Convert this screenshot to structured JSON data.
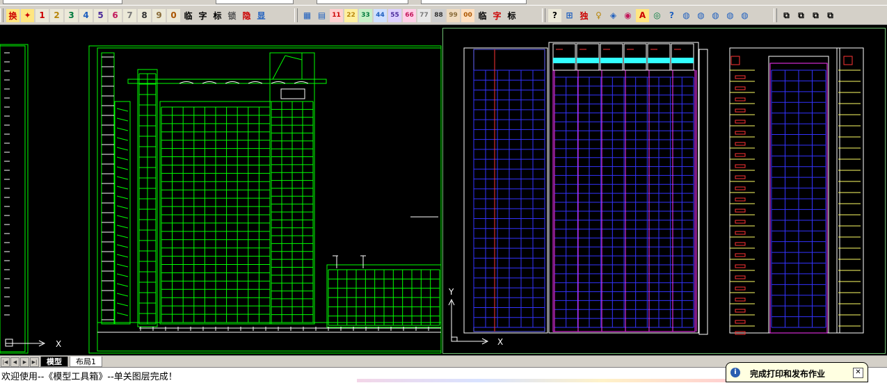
{
  "toolbar": {
    "group1": [
      {
        "label": "换",
        "color": "#cc0000",
        "bg": "#ffe680"
      },
      {
        "label": "✦",
        "color": "#cc0000",
        "bg": "#ffe680"
      },
      {
        "label": "1",
        "color": "#cc0000",
        "bg": "#ece9d8"
      },
      {
        "label": "2",
        "color": "#b8860b",
        "bg": "#ece9d8"
      },
      {
        "label": "3",
        "color": "#007a3d",
        "bg": "#ece9d8"
      },
      {
        "label": "4",
        "color": "#1e5fbf",
        "bg": "#ece9d8"
      },
      {
        "label": "5",
        "color": "#4b2b9b",
        "bg": "#ece9d8"
      },
      {
        "label": "6",
        "color": "#c2185b",
        "bg": "#ece9d8"
      },
      {
        "label": "7",
        "color": "#7a7a7a",
        "bg": "#ece9d8"
      },
      {
        "label": "8",
        "color": "#333333",
        "bg": "#ece9d8"
      },
      {
        "label": "9",
        "color": "#8a6d3b",
        "bg": "#ece9d8"
      },
      {
        "label": "0",
        "color": "#aa5500",
        "bg": "#ece9d8"
      },
      {
        "label": "临",
        "color": "#000000",
        "bg": "#d4d0c8"
      },
      {
        "label": "字",
        "color": "#000000",
        "bg": "#d4d0c8"
      },
      {
        "label": "标",
        "color": "#000000",
        "bg": "#d4d0c8"
      },
      {
        "label": "锁",
        "color": "#555555",
        "bg": "#d4d0c8"
      },
      {
        "label": "隐",
        "color": "#cc0000",
        "bg": "#d4d0c8"
      },
      {
        "label": "显",
        "color": "#1e5fbf",
        "bg": "#d4d0c8"
      }
    ],
    "group2": [
      {
        "label": "▦",
        "color": "#1e5fbf",
        "bg": "#d4d0c8"
      },
      {
        "label": "▤",
        "color": "#1e5fbf",
        "bg": "#d4d0c8"
      },
      {
        "label": "11",
        "color": "#cc0000",
        "bg": "#ffd0d0"
      },
      {
        "label": "22",
        "color": "#b8860b",
        "bg": "#fff0a0"
      },
      {
        "label": "33",
        "color": "#007a3d",
        "bg": "#c8f0c8"
      },
      {
        "label": "44",
        "color": "#1e5fbf",
        "bg": "#cfe0ff"
      },
      {
        "label": "55",
        "color": "#4b2b9b",
        "bg": "#ddd0ff"
      },
      {
        "label": "66",
        "color": "#c2185b",
        "bg": "#ffd0e8"
      },
      {
        "label": "77",
        "color": "#7a7a7a",
        "bg": "#e8e8e8"
      },
      {
        "label": "88",
        "color": "#333333",
        "bg": "#cfcfcf"
      },
      {
        "label": "99",
        "color": "#8a6d3b",
        "bg": "#f0dcc0"
      },
      {
        "label": "00",
        "color": "#aa5500",
        "bg": "#ffe0c0"
      },
      {
        "label": "临",
        "color": "#000000",
        "bg": "#d4d0c8"
      },
      {
        "label": "字",
        "color": "#cc0000",
        "bg": "#d4d0c8"
      },
      {
        "label": "标",
        "color": "#000000",
        "bg": "#d4d0c8"
      }
    ],
    "group3": [
      {
        "label": "?",
        "color": "#000000",
        "bg": "#ece9d8"
      },
      {
        "label": "⊞",
        "color": "#1e5fbf",
        "bg": "#d4d0c8"
      },
      {
        "label": "独",
        "color": "#cc0000",
        "bg": "#d4d0c8"
      },
      {
        "label": "♀",
        "color": "#b8860b",
        "bg": "#d4d0c8"
      },
      {
        "label": "◈",
        "color": "#1e5fbf",
        "bg": "#d4d0c8"
      },
      {
        "label": "◉",
        "color": "#c2185b",
        "bg": "#d4d0c8"
      },
      {
        "label": "A",
        "color": "#cc0000",
        "bg": "#ffe680"
      },
      {
        "label": "◎",
        "color": "#007a3d",
        "bg": "#d4d0c8"
      },
      {
        "label": "?",
        "color": "#1e5fbf",
        "bg": "#d4d0c8"
      },
      {
        "label": "◍",
        "color": "#1e5fbf",
        "bg": "#d4d0c8"
      },
      {
        "label": "◍",
        "color": "#1e5fbf",
        "bg": "#d4d0c8"
      },
      {
        "label": "◍",
        "color": "#1e5fbf",
        "bg": "#d4d0c8"
      },
      {
        "label": "◍",
        "color": "#1e5fbf",
        "bg": "#d4d0c8"
      },
      {
        "label": "◍",
        "color": "#1e5fbf",
        "bg": "#d4d0c8"
      }
    ],
    "group4": [
      {
        "label": "⧉",
        "color": "#000000",
        "bg": "#d4d0c8"
      },
      {
        "label": "⧉",
        "color": "#000000",
        "bg": "#d4d0c8"
      },
      {
        "label": "⧉",
        "color": "#000000",
        "bg": "#d4d0c8"
      },
      {
        "label": "⧉",
        "color": "#000000",
        "bg": "#d4d0c8"
      }
    ]
  },
  "viewport_left": {
    "ucs_x_label": "X"
  },
  "viewport_right": {
    "ucs_x_label": "X",
    "ucs_y_label": "Y"
  },
  "tabs": [
    {
      "label": "模型",
      "active": true
    },
    {
      "label": "布局1",
      "active": false
    }
  ],
  "nav_buttons": [
    "|◀",
    "◀",
    "▶",
    "▶|"
  ],
  "command": {
    "text": "欢迎使用--《模型工具箱》--单关图层完成！"
  },
  "notification": {
    "icon": "i",
    "text": "完成打印和发布作业",
    "close": "✕"
  }
}
